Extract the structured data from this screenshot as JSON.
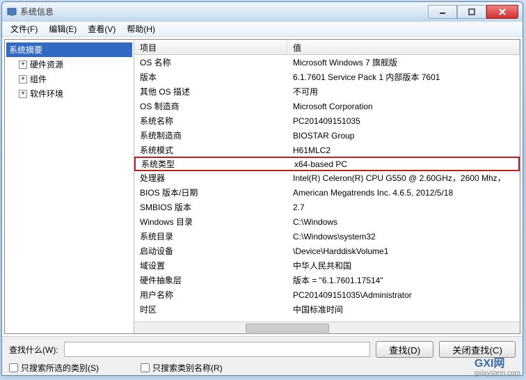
{
  "window": {
    "title": "系统信息"
  },
  "menubar": {
    "file": "文件(F)",
    "edit": "编辑(E)",
    "view": "查看(V)",
    "help": "帮助(H)"
  },
  "sidebar": {
    "root": "系统摘要",
    "items": [
      "硬件资源",
      "组件",
      "软件环境"
    ]
  },
  "list": {
    "header_name": "项目",
    "header_value": "值",
    "rows": [
      {
        "name": "OS 名称",
        "value": "Microsoft Windows 7 旗舰版",
        "highlight": false
      },
      {
        "name": "版本",
        "value": "6.1.7601 Service Pack 1 内部版本 7601",
        "highlight": false
      },
      {
        "name": "其他 OS 描述",
        "value": "不可用",
        "highlight": false
      },
      {
        "name": "OS 制造商",
        "value": "Microsoft Corporation",
        "highlight": false
      },
      {
        "name": "系统名称",
        "value": "PC201409151035",
        "highlight": false
      },
      {
        "name": "系统制造商",
        "value": "BIOSTAR Group",
        "highlight": false
      },
      {
        "name": "系统模式",
        "value": "H61MLC2",
        "highlight": false
      },
      {
        "name": "系统类型",
        "value": "x64-based PC",
        "highlight": true
      },
      {
        "name": "处理器",
        "value": "Intel(R) Celeron(R) CPU G550 @ 2.60GHz，2600 Mhz，",
        "highlight": false
      },
      {
        "name": "BIOS 版本/日期",
        "value": "American Megatrends Inc. 4.6.5, 2012/5/18",
        "highlight": false
      },
      {
        "name": "SMBIOS 版本",
        "value": "2.7",
        "highlight": false
      },
      {
        "name": "Windows 目录",
        "value": "C:\\Windows",
        "highlight": false
      },
      {
        "name": "系统目录",
        "value": "C:\\Windows\\system32",
        "highlight": false
      },
      {
        "name": "启动设备",
        "value": "\\Device\\HarddiskVolume1",
        "highlight": false
      },
      {
        "name": "域设置",
        "value": "中华人民共和国",
        "highlight": false
      },
      {
        "name": "硬件抽象层",
        "value": "版本 = \"6.1.7601.17514\"",
        "highlight": false
      },
      {
        "name": "用户名称",
        "value": "PC201409151035\\Administrator",
        "highlight": false
      },
      {
        "name": "时区",
        "value": "中国标准时间",
        "highlight": false
      }
    ]
  },
  "footer": {
    "search_label": "查找什么(W):",
    "find_btn": "查找(D)",
    "close_find_btn": "关闭查找(C)",
    "chk_selected": "只搜索所选的类别(S)",
    "chk_names": "只搜索类别名称(R)",
    "search_value": ""
  },
  "watermark": {
    "brand": "GXI网",
    "sub": "gxisystem.com"
  }
}
